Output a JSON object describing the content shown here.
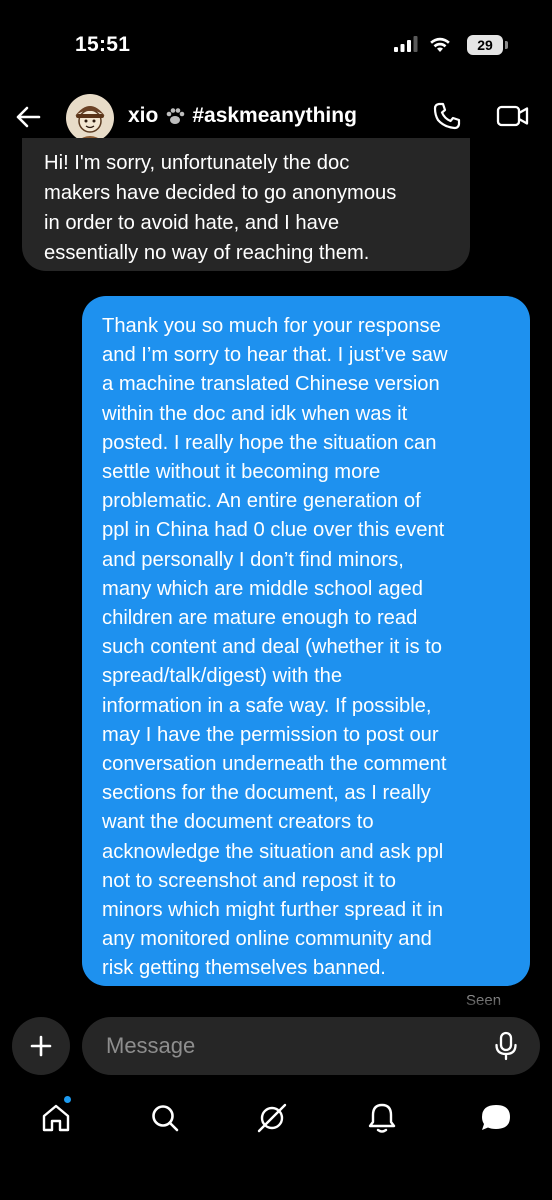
{
  "status_bar": {
    "time": "15:51",
    "battery": "29"
  },
  "header": {
    "name": "xio",
    "hashtag": "#askmeanything"
  },
  "messages": {
    "incoming": [
      "Hi! I'm sorry, unfortunately the doc",
      "makers have decided to go anonymous",
      "in order to avoid hate, and I have",
      "essentially no way of reaching them."
    ],
    "outgoing": [
      "Thank you so much for your response",
      "and I’m sorry to hear that. I just’ve saw",
      "a machine translated Chinese version",
      "within the doc and idk when was it",
      "posted. I really hope the situation can",
      "settle without it becoming more",
      "problematic. An entire generation of",
      "ppl in China had 0 clue over this event",
      "and personally I don’t find minors,",
      "many which are middle school aged",
      "children are mature enough to read",
      "such content and deal (whether it is to",
      "spread/talk/digest) with the",
      "information in a safe way. If possible,",
      "may I have the permission to post our",
      "conversation underneath the comment",
      "sections  for the document, as I really",
      "want the document creators to",
      "acknowledge the situation and ask ppl",
      "not to screenshot and repost it to",
      "minors which might further spread it in",
      "any monitored online community and",
      "risk getting themselves banned."
    ],
    "seen_label": "Seen"
  },
  "composer": {
    "placeholder": "Message"
  },
  "icons": {
    "back": "back-arrow-icon",
    "call": "phone-icon",
    "video": "video-camera-icon",
    "plus": "plus-icon",
    "mic": "microphone-icon",
    "nav": [
      "home-icon",
      "search-icon",
      "grok-icon",
      "bell-icon",
      "messages-icon"
    ]
  },
  "colors": {
    "outgoing_bubble": "#1e91ef",
    "incoming_bubble": "#262626",
    "accent": "#1d9bf0"
  }
}
